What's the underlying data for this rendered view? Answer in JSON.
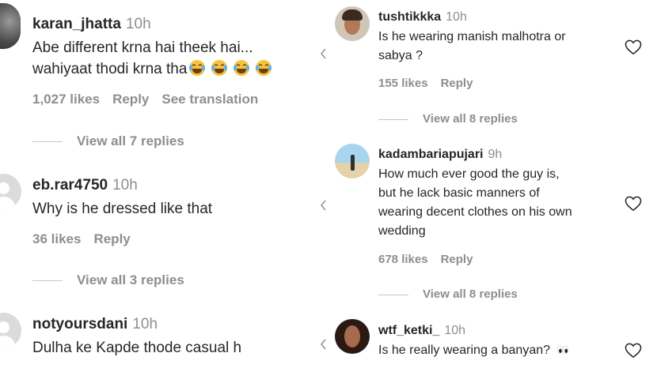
{
  "left": {
    "comments": [
      {
        "username": "karan_jhatta",
        "time": "10h",
        "text_lines": [
          "Abe different krna hai theek hai...",
          "wahiyaat thodi krna tha"
        ],
        "emoji": "face-with-tears-of-joy",
        "emoji_count": 4,
        "likes": "1,027 likes",
        "reply": "Reply",
        "translate": "See translation",
        "view_replies": "View all 7 replies"
      },
      {
        "username": "eb.rar4750",
        "time": "10h",
        "text": "Why is he dressed like that",
        "likes": "36 likes",
        "reply": "Reply",
        "view_replies": "View all 3 replies"
      },
      {
        "username": "notyoursdani",
        "time": "10h",
        "text": "Dulha ke Kapde thode casual h"
      }
    ]
  },
  "right": {
    "comments": [
      {
        "username": "tushtikkka",
        "time": "10h",
        "text_lines": [
          "Is he wearing manish malhotra or",
          "sabya ?"
        ],
        "likes": "155 likes",
        "reply": "Reply",
        "view_replies": "View all 8 replies"
      },
      {
        "username": "kadambariapujari",
        "time": "9h",
        "text_lines": [
          "How much ever good the guy is,",
          "but he lack basic manners of",
          "wearing decent clothes on his own",
          "wedding"
        ],
        "likes": "678 likes",
        "reply": "Reply",
        "view_replies": "View all 8 replies"
      },
      {
        "username": "wtf_ketki_",
        "time": "10h",
        "text": "Is he really wearing a banyan?",
        "emoji": "eyes"
      }
    ]
  },
  "icons": {
    "like": "heart-outline-icon",
    "truncated": "chevron-left-icon"
  },
  "colors": {
    "text": "#262626",
    "secondary": "#8e8e8e",
    "divider": "#c7c7c7",
    "avatar_placeholder": "#dbdbdb",
    "emoji_yellow": "#f7c23c"
  }
}
